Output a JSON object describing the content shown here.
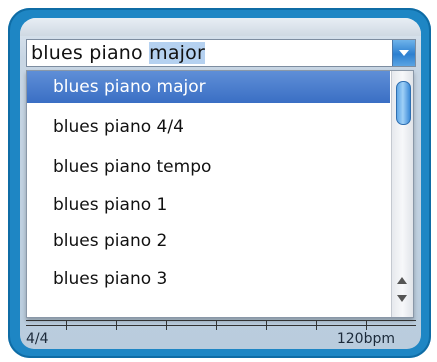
{
  "combo": {
    "value_prefix": "blues piano ",
    "value_selected": "major"
  },
  "dropdown": {
    "items": [
      {
        "label": "blues piano major",
        "selected": true
      },
      {
        "label": "blues piano 4/4",
        "selected": false
      },
      {
        "label": "blues piano tempo",
        "selected": false
      },
      {
        "label": "blues piano 1",
        "selected": false
      },
      {
        "label": "blues piano 2",
        "selected": false
      },
      {
        "label": "blues piano 3",
        "selected": false
      }
    ]
  },
  "status": {
    "time_signature": "4/4",
    "tempo": "120bpm"
  },
  "colors": {
    "frame": "#1e86c4",
    "selection": "#3a6fc4"
  }
}
